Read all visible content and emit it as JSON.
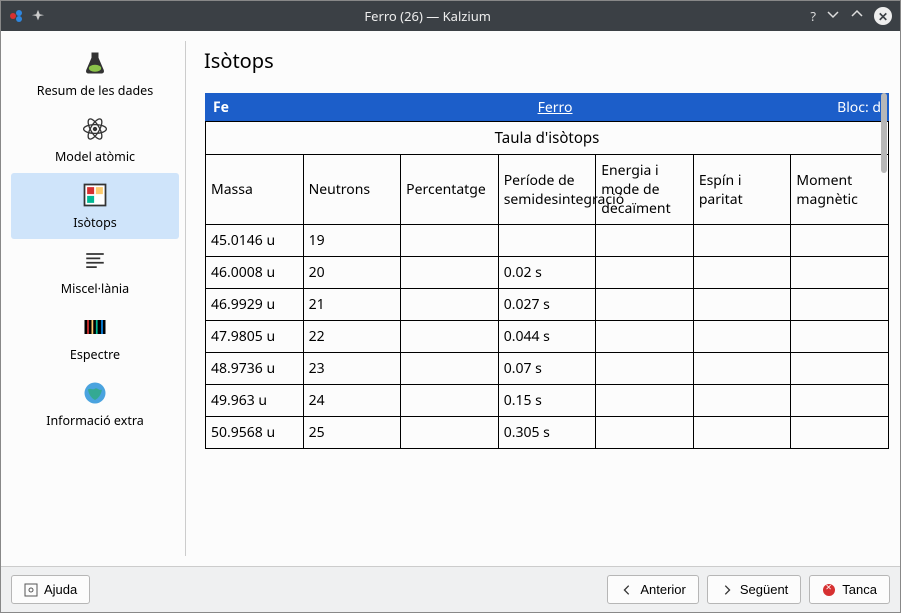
{
  "window": {
    "title": "Ferro (26) — Kalzium"
  },
  "sidebar": {
    "items": [
      {
        "label": "Resum de les dades"
      },
      {
        "label": "Model atòmic"
      },
      {
        "label": "Isòtops"
      },
      {
        "label": "Miscel·lània"
      },
      {
        "label": "Espectre"
      },
      {
        "label": "Informació extra"
      }
    ]
  },
  "page": {
    "title": "Isòtops"
  },
  "element_header": {
    "symbol": "Fe",
    "name": "Ferro",
    "block": "Bloc: d"
  },
  "table": {
    "caption": "Taula d'isòtops",
    "headers": {
      "mass": "Massa",
      "neutrons": "Neutrons",
      "percentage": "Percentatge",
      "halflife": "Període de semidesintegració",
      "energy": "Energia i mode de decaïment",
      "spin": "Espín i paritat",
      "magnetic": "Moment magnètic"
    },
    "rows": [
      {
        "mass": "45.0146 u",
        "neutrons": "19",
        "pct": "",
        "half": "",
        "energy": "",
        "spin": "",
        "mag": ""
      },
      {
        "mass": "46.0008 u",
        "neutrons": "20",
        "pct": "",
        "half": "0.02 s",
        "energy": "",
        "spin": "",
        "mag": ""
      },
      {
        "mass": "46.9929 u",
        "neutrons": "21",
        "pct": "",
        "half": "0.027 s",
        "energy": "",
        "spin": "",
        "mag": ""
      },
      {
        "mass": "47.9805 u",
        "neutrons": "22",
        "pct": "",
        "half": "0.044 s",
        "energy": "",
        "spin": "",
        "mag": ""
      },
      {
        "mass": "48.9736 u",
        "neutrons": "23",
        "pct": "",
        "half": "0.07 s",
        "energy": "",
        "spin": "",
        "mag": ""
      },
      {
        "mass": "49.963 u",
        "neutrons": "24",
        "pct": "",
        "half": "0.15 s",
        "energy": "",
        "spin": "",
        "mag": ""
      },
      {
        "mass": "50.9568 u",
        "neutrons": "25",
        "pct": "",
        "half": "0.305 s",
        "energy": "",
        "spin": "",
        "mag": ""
      }
    ]
  },
  "footer": {
    "help": "Ajuda",
    "prev": "Anterior",
    "next": "Següent",
    "close": "Tanca"
  }
}
